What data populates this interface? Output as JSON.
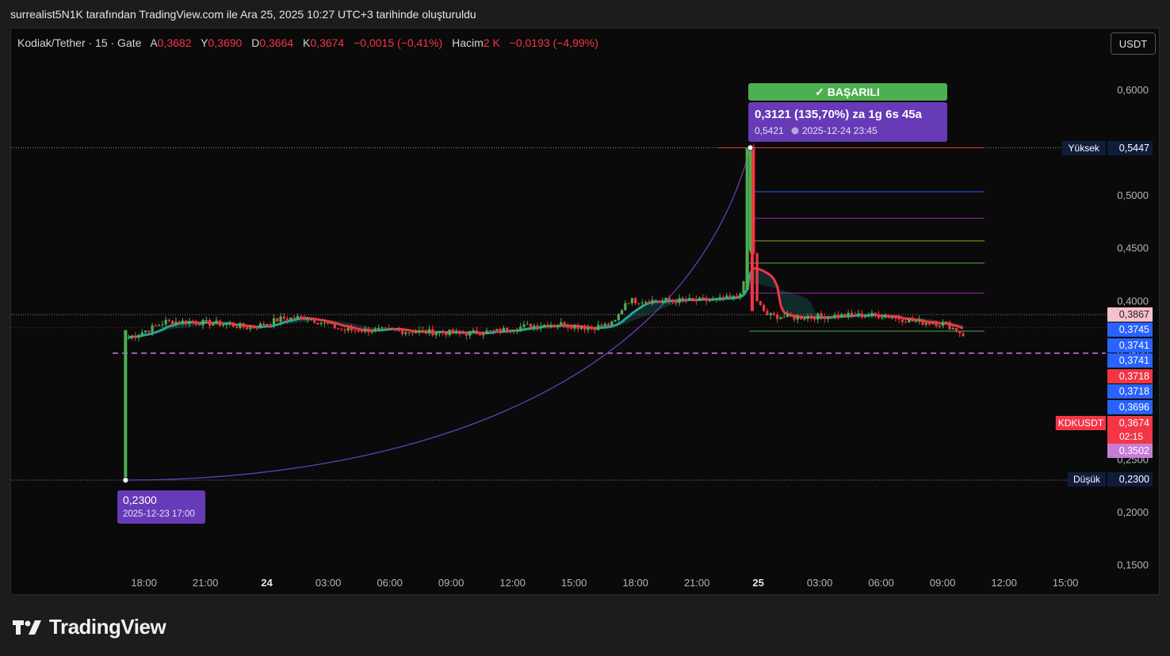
{
  "caption": "surrealist5N1K tarafından TradingView.com ile Ara 25, 2025 10:27 UTC+3 tarihinde oluşturuldu",
  "legend": {
    "symbol": "Kodiak/Tether · 15 · Gate",
    "open_label": "A",
    "open": "0,3682",
    "high_label": "Y",
    "high": "0,3690",
    "low_label": "D",
    "low": "0,3664",
    "close_label": "K",
    "close": "0,3674",
    "change": "−0,0015 (−0,41%)",
    "volume_label": "Hacim",
    "volume": "2 K",
    "volume_change": "−0,0193 (−4,99%)"
  },
  "currency_button": "USDT",
  "brand": "TradingView",
  "colors": {
    "up": "#4caf50",
    "down": "#f23645",
    "teal": "#26a69a",
    "purple": "#673ab7",
    "success": "#4caf50"
  },
  "chart_data": {
    "type": "candlestick",
    "y_axis": {
      "min": 0.13,
      "max": 0.62,
      "ticks": [
        0.15,
        0.2,
        0.25,
        0.3,
        0.35,
        0.4,
        0.45,
        0.5,
        0.6
      ],
      "tick_labels": [
        "0,1500",
        "0,2000",
        "0,2500",
        "0,3000",
        "0,3500",
        "0,4000",
        "0,4500",
        "0,5000",
        "0,6000"
      ]
    },
    "x_axis": {
      "ticks": [
        {
          "x": -0.25,
          "label": "18:00",
          "bold": false
        },
        {
          "x": 0.75,
          "label": "21:00",
          "bold": false
        },
        {
          "x": 1.75,
          "label": "24",
          "bold": true
        },
        {
          "x": 2.75,
          "label": "03:00",
          "bold": false
        },
        {
          "x": 3.75,
          "label": "06:00",
          "bold": false
        },
        {
          "x": 4.75,
          "label": "09:00",
          "bold": false
        },
        {
          "x": 5.75,
          "label": "12:00",
          "bold": false
        },
        {
          "x": 6.75,
          "label": "15:00",
          "bold": false
        },
        {
          "x": 7.75,
          "label": "18:00",
          "bold": false
        },
        {
          "x": 8.75,
          "label": "21:00",
          "bold": false
        },
        {
          "x": 9.75,
          "label": "25",
          "bold": true
        },
        {
          "x": 10.75,
          "label": "03:00",
          "bold": false
        },
        {
          "x": 11.75,
          "label": "06:00",
          "bold": false
        },
        {
          "x": 12.75,
          "label": "09:00",
          "bold": false
        },
        {
          "x": 13.75,
          "label": "12:00",
          "bold": false
        },
        {
          "x": 14.75,
          "label": "15:00",
          "bold": false
        }
      ]
    },
    "series": [
      {
        "name": "KDKUSDT",
        "key_points": [
          [
            -0.55,
            0.23
          ],
          [
            -0.5,
            0.365
          ],
          [
            -0.2,
            0.372
          ],
          [
            0.1,
            0.38
          ],
          [
            0.4,
            0.38
          ],
          [
            1.0,
            0.378
          ],
          [
            1.5,
            0.374
          ],
          [
            2.0,
            0.383
          ],
          [
            2.4,
            0.384
          ],
          [
            3.0,
            0.372
          ],
          [
            3.5,
            0.372
          ],
          [
            4.0,
            0.371
          ],
          [
            4.5,
            0.37
          ],
          [
            5.0,
            0.369
          ],
          [
            5.5,
            0.371
          ],
          [
            6.0,
            0.376
          ],
          [
            6.5,
            0.378
          ],
          [
            7.0,
            0.374
          ],
          [
            7.4,
            0.378
          ],
          [
            7.6,
            0.4
          ],
          [
            7.8,
            0.4
          ],
          [
            8.2,
            0.4
          ],
          [
            8.6,
            0.4
          ],
          [
            9.0,
            0.4
          ],
          [
            9.4,
            0.403
          ],
          [
            9.55,
            0.42
          ],
          [
            9.62,
            0.5447
          ],
          [
            9.7,
            0.4
          ],
          [
            9.9,
            0.386
          ],
          [
            10.3,
            0.384
          ],
          [
            10.7,
            0.385
          ],
          [
            11.2,
            0.386
          ],
          [
            11.8,
            0.386
          ],
          [
            12.3,
            0.38
          ],
          [
            12.8,
            0.378
          ],
          [
            13.1,
            0.3674
          ]
        ]
      }
    ],
    "price_labels": [
      {
        "value": "0,5447",
        "color": "#0f1d3a",
        "tag": "Yüksek",
        "y": 0.5447
      },
      {
        "value": "0,3867",
        "color": "#f7c1c9",
        "y": 0.3867
      },
      {
        "value": "0,3745",
        "color": "#2962ff",
        "y": 0.3745
      },
      {
        "value": "0,3741",
        "color": "#2962ff",
        "y": 0.3741
      },
      {
        "value": "0,3741",
        "color": "#2962ff",
        "y": 0.3741
      },
      {
        "value": "0,3718",
        "color": "#f23645",
        "y": 0.3718
      },
      {
        "value": "0,3718",
        "color": "#2962ff",
        "y": 0.3718
      },
      {
        "value": "0,3696",
        "color": "#2962ff",
        "y": 0.3696
      },
      {
        "value": "0,3674",
        "color": "#f23645",
        "tag": "KDKUSDT",
        "countdown": "02:15",
        "y": 0.3674
      },
      {
        "value": "0,3502",
        "color": "#c77dd8",
        "y": 0.3502
      },
      {
        "value": "0,2300",
        "color": "#0f1d3a",
        "tag": "Düşük",
        "y": 0.23
      }
    ],
    "annotations": {
      "success_label": "✓ BAŞARILI",
      "move": "0,3121 (135,70%) za 1g 6s 45a",
      "peak_price": "0,5421",
      "peak_time": "2025-12-24 23:45",
      "low_price": "0,2300",
      "low_time": "2025-12-23 17:00"
    },
    "fib_levels": [
      0.5447,
      0.503,
      0.478,
      0.4565,
      0.4355,
      0.407,
      0.371
    ]
  }
}
